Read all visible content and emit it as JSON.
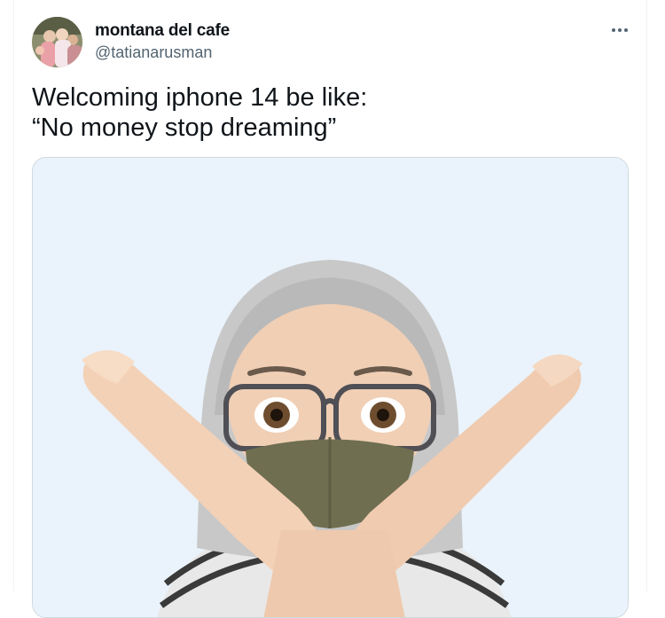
{
  "tweet": {
    "display_name": "montana del cafe",
    "handle": "@tatianarusman",
    "text_lines": [
      "Welcoming iphone 14 be like:",
      "“No money stop dreaming”"
    ],
    "more_icon": "more-horizontal-icon",
    "media_description_icon": "memoji-crossed-arms-image"
  },
  "colors": {
    "text_primary": "#0f1419",
    "text_secondary": "#536471",
    "media_background": "#eaf3fb",
    "border": "#cfd9de"
  }
}
